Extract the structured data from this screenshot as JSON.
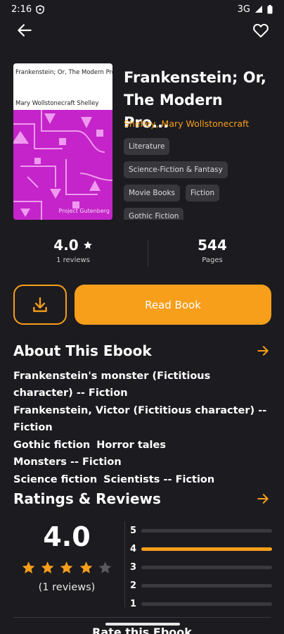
{
  "status": {
    "time": "2:16",
    "network": "3G"
  },
  "book": {
    "title": "Frankenstein; Or, The Modern Pro...",
    "author": "Shelley, Mary Wollstonecraft",
    "cover_title": "Frankenstein; Or, The Modern Prometheus",
    "cover_author": "Mary Wollstonecraft Shelley",
    "cover_publisher": "Project Gutenberg",
    "cover_color": "#c424c9",
    "tags": [
      "Literature",
      "Science-Fiction & Fantasy",
      "Movie Books",
      "Fiction",
      "Gothic Fiction"
    ]
  },
  "stats": {
    "rating": "4.0",
    "reviews_label": "1 reviews",
    "pages": "544",
    "pages_label": "Pages"
  },
  "actions": {
    "read_label": "Read Book"
  },
  "about": {
    "title": "About This Ebook",
    "subjects": [
      [
        "Frankenstein's monster (Fictitious character) -- Fiction"
      ],
      [
        "Frankenstein, Victor (Fictitious character) -- Fiction"
      ],
      [
        "Gothic fiction",
        "Horror tales",
        "Monsters -- Fiction"
      ],
      [
        "Science fiction",
        "Scientists -- Fiction"
      ]
    ]
  },
  "ratings": {
    "title": "Ratings & Reviews",
    "average": "4.0",
    "stars_filled": 4,
    "stars_total": 5,
    "count_label": "(1 reviews)",
    "distribution": [
      {
        "label": "5",
        "fraction": 0
      },
      {
        "label": "4",
        "fraction": 1
      },
      {
        "label": "3",
        "fraction": 0
      },
      {
        "label": "2",
        "fraction": 0
      },
      {
        "label": "1",
        "fraction": 0
      }
    ]
  },
  "rate_label": "Rate this Ebook",
  "colors": {
    "accent": "#f79e1b",
    "background": "#1c1b1f",
    "chip": "#38373c"
  },
  "icons": {
    "back": "arrow-left-icon",
    "favorite": "heart-outline-icon",
    "download": "download-icon",
    "star": "star-icon",
    "forward": "arrow-right-icon"
  }
}
